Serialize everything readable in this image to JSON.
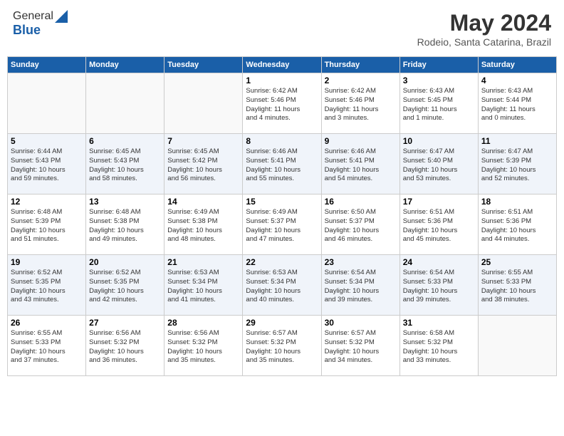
{
  "header": {
    "logo_line1": "General",
    "logo_line2": "Blue",
    "month": "May 2024",
    "location": "Rodeio, Santa Catarina, Brazil"
  },
  "weekdays": [
    "Sunday",
    "Monday",
    "Tuesday",
    "Wednesday",
    "Thursday",
    "Friday",
    "Saturday"
  ],
  "weeks": [
    [
      {
        "day": "",
        "info": ""
      },
      {
        "day": "",
        "info": ""
      },
      {
        "day": "",
        "info": ""
      },
      {
        "day": "1",
        "info": "Sunrise: 6:42 AM\nSunset: 5:46 PM\nDaylight: 11 hours\nand 4 minutes."
      },
      {
        "day": "2",
        "info": "Sunrise: 6:42 AM\nSunset: 5:46 PM\nDaylight: 11 hours\nand 3 minutes."
      },
      {
        "day": "3",
        "info": "Sunrise: 6:43 AM\nSunset: 5:45 PM\nDaylight: 11 hours\nand 1 minute."
      },
      {
        "day": "4",
        "info": "Sunrise: 6:43 AM\nSunset: 5:44 PM\nDaylight: 11 hours\nand 0 minutes."
      }
    ],
    [
      {
        "day": "5",
        "info": "Sunrise: 6:44 AM\nSunset: 5:43 PM\nDaylight: 10 hours\nand 59 minutes."
      },
      {
        "day": "6",
        "info": "Sunrise: 6:45 AM\nSunset: 5:43 PM\nDaylight: 10 hours\nand 58 minutes."
      },
      {
        "day": "7",
        "info": "Sunrise: 6:45 AM\nSunset: 5:42 PM\nDaylight: 10 hours\nand 56 minutes."
      },
      {
        "day": "8",
        "info": "Sunrise: 6:46 AM\nSunset: 5:41 PM\nDaylight: 10 hours\nand 55 minutes."
      },
      {
        "day": "9",
        "info": "Sunrise: 6:46 AM\nSunset: 5:41 PM\nDaylight: 10 hours\nand 54 minutes."
      },
      {
        "day": "10",
        "info": "Sunrise: 6:47 AM\nSunset: 5:40 PM\nDaylight: 10 hours\nand 53 minutes."
      },
      {
        "day": "11",
        "info": "Sunrise: 6:47 AM\nSunset: 5:39 PM\nDaylight: 10 hours\nand 52 minutes."
      }
    ],
    [
      {
        "day": "12",
        "info": "Sunrise: 6:48 AM\nSunset: 5:39 PM\nDaylight: 10 hours\nand 51 minutes."
      },
      {
        "day": "13",
        "info": "Sunrise: 6:48 AM\nSunset: 5:38 PM\nDaylight: 10 hours\nand 49 minutes."
      },
      {
        "day": "14",
        "info": "Sunrise: 6:49 AM\nSunset: 5:38 PM\nDaylight: 10 hours\nand 48 minutes."
      },
      {
        "day": "15",
        "info": "Sunrise: 6:49 AM\nSunset: 5:37 PM\nDaylight: 10 hours\nand 47 minutes."
      },
      {
        "day": "16",
        "info": "Sunrise: 6:50 AM\nSunset: 5:37 PM\nDaylight: 10 hours\nand 46 minutes."
      },
      {
        "day": "17",
        "info": "Sunrise: 6:51 AM\nSunset: 5:36 PM\nDaylight: 10 hours\nand 45 minutes."
      },
      {
        "day": "18",
        "info": "Sunrise: 6:51 AM\nSunset: 5:36 PM\nDaylight: 10 hours\nand 44 minutes."
      }
    ],
    [
      {
        "day": "19",
        "info": "Sunrise: 6:52 AM\nSunset: 5:35 PM\nDaylight: 10 hours\nand 43 minutes."
      },
      {
        "day": "20",
        "info": "Sunrise: 6:52 AM\nSunset: 5:35 PM\nDaylight: 10 hours\nand 42 minutes."
      },
      {
        "day": "21",
        "info": "Sunrise: 6:53 AM\nSunset: 5:34 PM\nDaylight: 10 hours\nand 41 minutes."
      },
      {
        "day": "22",
        "info": "Sunrise: 6:53 AM\nSunset: 5:34 PM\nDaylight: 10 hours\nand 40 minutes."
      },
      {
        "day": "23",
        "info": "Sunrise: 6:54 AM\nSunset: 5:34 PM\nDaylight: 10 hours\nand 39 minutes."
      },
      {
        "day": "24",
        "info": "Sunrise: 6:54 AM\nSunset: 5:33 PM\nDaylight: 10 hours\nand 39 minutes."
      },
      {
        "day": "25",
        "info": "Sunrise: 6:55 AM\nSunset: 5:33 PM\nDaylight: 10 hours\nand 38 minutes."
      }
    ],
    [
      {
        "day": "26",
        "info": "Sunrise: 6:55 AM\nSunset: 5:33 PM\nDaylight: 10 hours\nand 37 minutes."
      },
      {
        "day": "27",
        "info": "Sunrise: 6:56 AM\nSunset: 5:32 PM\nDaylight: 10 hours\nand 36 minutes."
      },
      {
        "day": "28",
        "info": "Sunrise: 6:56 AM\nSunset: 5:32 PM\nDaylight: 10 hours\nand 35 minutes."
      },
      {
        "day": "29",
        "info": "Sunrise: 6:57 AM\nSunset: 5:32 PM\nDaylight: 10 hours\nand 35 minutes."
      },
      {
        "day": "30",
        "info": "Sunrise: 6:57 AM\nSunset: 5:32 PM\nDaylight: 10 hours\nand 34 minutes."
      },
      {
        "day": "31",
        "info": "Sunrise: 6:58 AM\nSunset: 5:32 PM\nDaylight: 10 hours\nand 33 minutes."
      },
      {
        "day": "",
        "info": ""
      }
    ]
  ]
}
